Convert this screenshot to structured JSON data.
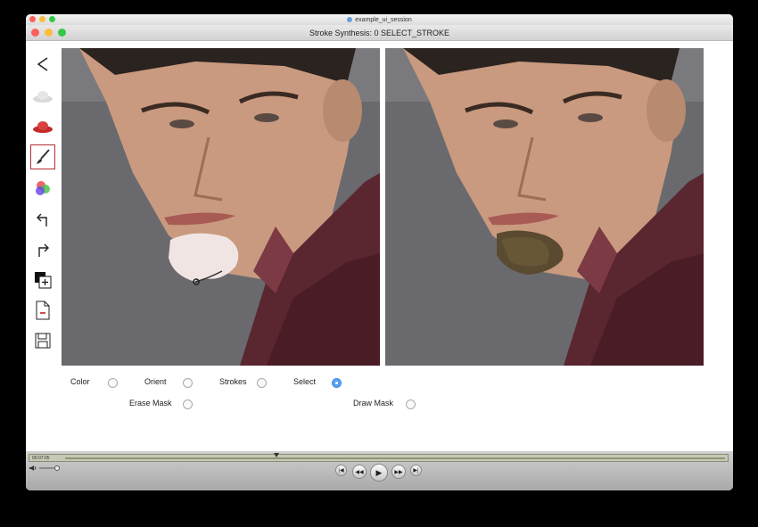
{
  "outer_window": {
    "title": "example_ui_session"
  },
  "window": {
    "title": "Stroke Synthesis: 0 SELECT_STROKE"
  },
  "toolbar": {
    "tools": [
      {
        "name": "back-icon",
        "active": false
      },
      {
        "name": "white-hat-icon",
        "active": false
      },
      {
        "name": "red-hat-icon",
        "active": false
      },
      {
        "name": "brush-icon",
        "active": true
      },
      {
        "name": "color-circles-icon",
        "active": false
      },
      {
        "name": "undo-icon",
        "active": false
      },
      {
        "name": "redo-icon",
        "active": false
      },
      {
        "name": "new-layer-icon",
        "active": false
      },
      {
        "name": "delete-document-icon",
        "active": false
      },
      {
        "name": "save-icon",
        "active": false
      }
    ]
  },
  "options": {
    "color": {
      "label": "Color",
      "selected": false
    },
    "orient": {
      "label": "Orient",
      "selected": false
    },
    "strokes": {
      "label": "Strokes",
      "selected": false
    },
    "select": {
      "label": "Select",
      "selected": true
    },
    "erase_mask": {
      "label": "Erase Mask",
      "selected": false
    },
    "draw_mask": {
      "label": "Draw Mask",
      "selected": false
    }
  },
  "player": {
    "time": "00:07:05",
    "progress": 0.32
  },
  "colors": {
    "accent": "#5aa0ef",
    "active_tool_border": "#b03030"
  }
}
